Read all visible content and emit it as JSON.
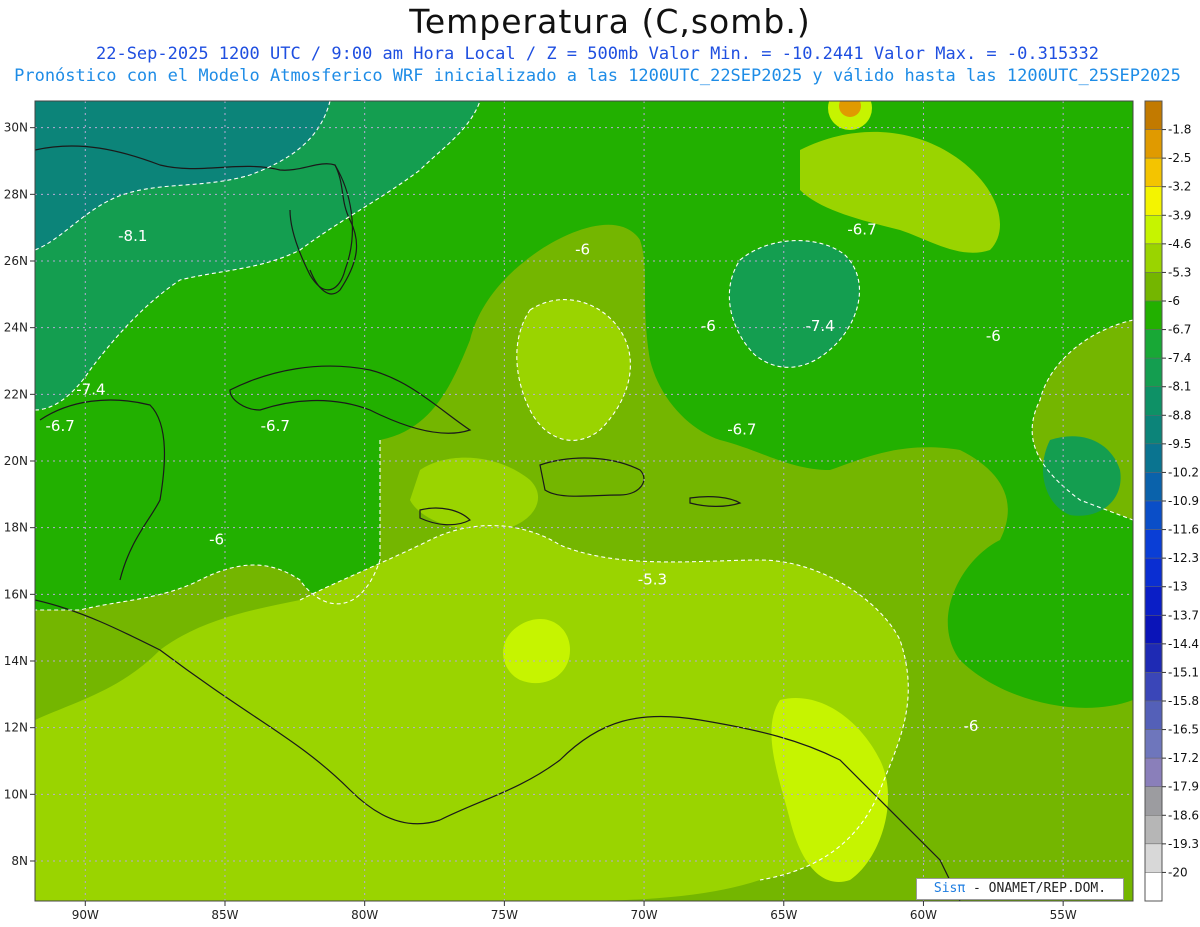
{
  "title": "Temperatura (C,somb.)",
  "subtitle_line1": "22-Sep-2025  1200 UTC / 9:00 am Hora Local / Z = 500mb  Valor Min. = -10.2441  Valor Max. = -0.315332",
  "subtitle_line2": "Pronóstico con el Modelo Atmosferico WRF inicializado a las 1200UTC_22SEP2025 y válido hasta las  1200UTC_25SEP2025",
  "credit": {
    "logo": "Sisπ",
    "text": " - ONAMET/REP.DOM."
  },
  "map": {
    "lon_range": [
      -91.8,
      -52.5
    ],
    "lat_range": [
      6.8,
      30.8
    ],
    "lon_ticks": [
      "90W",
      "85W",
      "80W",
      "75W",
      "70W",
      "65W",
      "60W",
      "55W"
    ],
    "lon_tick_values": [
      -90,
      -85,
      -80,
      -75,
      -70,
      -65,
      -60,
      -55
    ],
    "lat_ticks": [
      "8N",
      "10N",
      "12N",
      "14N",
      "16N",
      "18N",
      "20N",
      "22N",
      "24N",
      "26N",
      "28N",
      "30N"
    ],
    "lat_tick_values": [
      8,
      10,
      12,
      14,
      16,
      18,
      20,
      22,
      24,
      26,
      28,
      30
    ],
    "gridlines": true,
    "contour_labels": [
      {
        "text": "-8.1",
        "lon": -88.3,
        "lat": 26.6
      },
      {
        "text": "-6",
        "lon": -72.2,
        "lat": 26.2
      },
      {
        "text": "-6.7",
        "lon": -62.2,
        "lat": 26.8
      },
      {
        "text": "-6",
        "lon": -67.7,
        "lat": 23.9
      },
      {
        "text": "-7.4",
        "lon": -63.7,
        "lat": 23.9
      },
      {
        "text": "-6",
        "lon": -57.5,
        "lat": 23.6
      },
      {
        "text": "-7.4",
        "lon": -89.8,
        "lat": 22.0
      },
      {
        "text": "-6.7",
        "lon": -90.9,
        "lat": 20.9
      },
      {
        "text": "-6.7",
        "lon": -83.2,
        "lat": 20.9
      },
      {
        "text": "-6.7",
        "lon": -66.5,
        "lat": 20.8
      },
      {
        "text": "-6",
        "lon": -85.3,
        "lat": 17.5
      },
      {
        "text": "-5.3",
        "lon": -69.7,
        "lat": 16.3
      },
      {
        "text": "-6",
        "lon": -58.3,
        "lat": 11.9
      }
    ]
  },
  "colorbar": {
    "labels": [
      "-1.8",
      "-2.5",
      "-3.2",
      "-3.9",
      "-4.6",
      "-5.3",
      "-6",
      "-6.7",
      "-7.4",
      "-8.1",
      "-8.8",
      "-9.5",
      "-10.2",
      "-10.9",
      "-11.6",
      "-12.3",
      "-13",
      "-13.7",
      "-14.4",
      "-15.1",
      "-15.8",
      "-16.5",
      "-17.2",
      "-17.9",
      "-18.6",
      "-19.3",
      "-20"
    ],
    "colors": [
      "#c27a00",
      "#e09a00",
      "#f4c400",
      "#f4f400",
      "#c6f400",
      "#9ad400",
      "#74b600",
      "#22b000",
      "#18a836",
      "#149e50",
      "#0e9166",
      "#0c8479",
      "#0a7490",
      "#0a62ab",
      "#0a4ec8",
      "#0a3ed6",
      "#0a2ed2",
      "#0a1ec6",
      "#0a14b8",
      "#1e2ab4",
      "#3a46b8",
      "#5460b8",
      "#6e76bc",
      "#8a7fba",
      "#9c9ca0",
      "#b6b6b6",
      "#d8d8d8",
      "#ffffff"
    ]
  },
  "field_colors": {
    "t_103": "#74b600",
    "t_97": "#22b000",
    "t_90": "#149e50",
    "t_82": "#0c8479",
    "t_4": "#9ad400",
    "t_35": "#c6f400",
    "t_2": "#e09a00"
  }
}
